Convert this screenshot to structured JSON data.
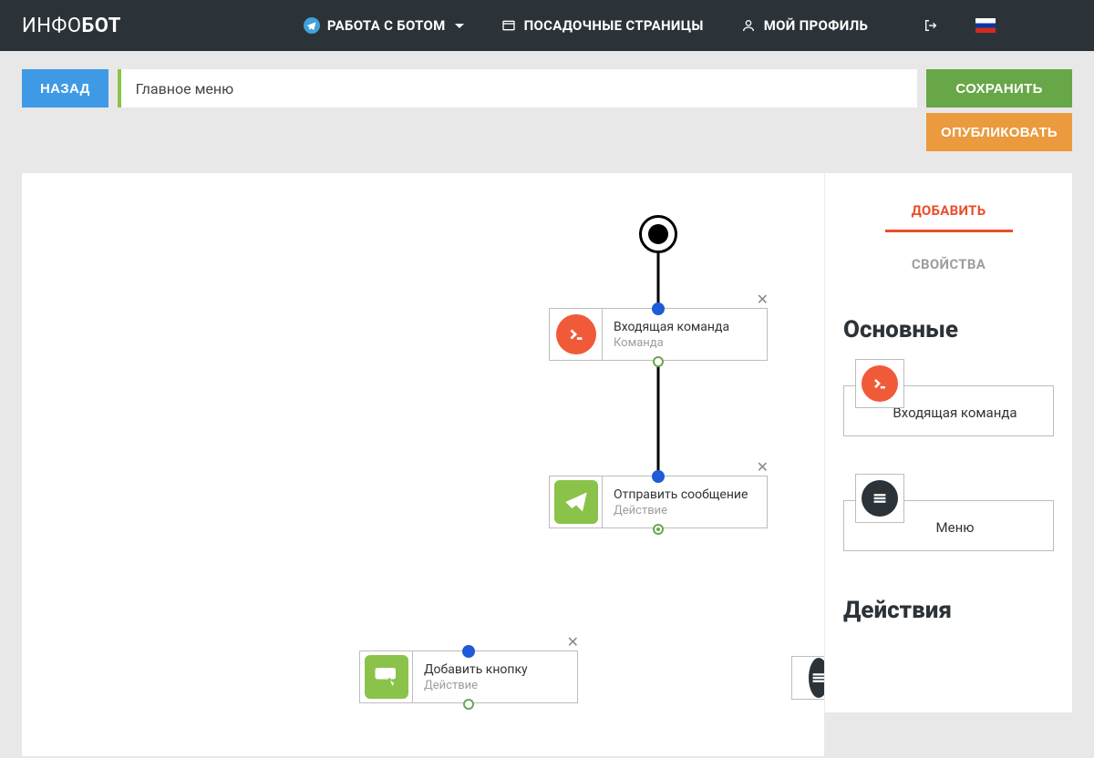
{
  "brand": {
    "part1": "ИНФО",
    "part2": "БОТ"
  },
  "nav": {
    "bot": "РАБОТА С БОТОМ",
    "landing": "ПОСАДОЧНЫЕ СТРАНИЦЫ",
    "profile": "МОЙ ПРОФИЛЬ"
  },
  "topbar": {
    "back": "НАЗАД",
    "title": "Главное меню",
    "save": "СОХРАНИТЬ",
    "publish": "ОПУБЛИКОВАТЬ"
  },
  "tabs": {
    "add": "ДОБАВИТЬ",
    "props": "СВОЙСТВА"
  },
  "sections": {
    "basic": "Основные",
    "actions": "Действия"
  },
  "palette": {
    "incoming": "Входящая команда",
    "menu": "Меню"
  },
  "nodes": {
    "n1": {
      "title": "Входящая команда",
      "sub": "Команда"
    },
    "n2": {
      "title": "Отправить сообщение",
      "sub": "Действие"
    },
    "n3": {
      "title": "Добавить кнопку",
      "sub": "Действие"
    }
  }
}
